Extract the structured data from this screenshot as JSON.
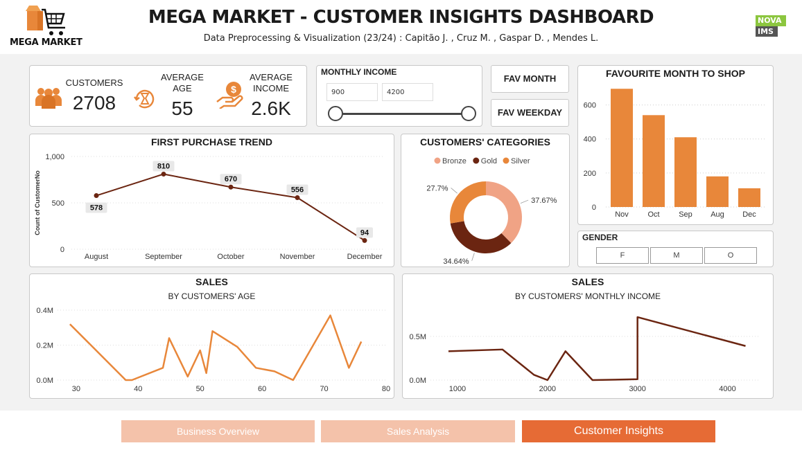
{
  "header": {
    "logo_text": "MEGA MARKET",
    "title": "MEGA MARKET - CUSTOMER INSIGHTS DASHBOARD",
    "subtitle": "Data Preprocessing & Visualization (23/24) : Capitão J. ,  Cruz M. ,  Gaspar D. ,  Mendes L.",
    "badge_top": "NOVA",
    "badge_bottom": "IMS",
    "colors": {
      "accent": "#e8873a",
      "dark": "#6b2511",
      "light_accent": "#f4c2aa",
      "active_nav": "#e66b35"
    }
  },
  "kpis": {
    "customers_label": "CUSTOMERS",
    "customers_value": "2708",
    "age_label_1": "AVERAGE",
    "age_label_2": "AGE",
    "age_value": "55",
    "income_label_1": "AVERAGE",
    "income_label_2": "INCOME",
    "income_value": "2.6K",
    "icons": [
      "people-icon",
      "hourglass-icon",
      "money-hand-icon"
    ]
  },
  "income_slicer": {
    "title": "MONTHLY INCOME",
    "min_value": "900",
    "max_value": "4200"
  },
  "buttons": {
    "fav_month": "FAV MONTH",
    "fav_weekday": "FAV WEEKDAY"
  },
  "fav_month_chart": {
    "title": "FAVOURITE MONTH TO SHOP"
  },
  "first_purchase": {
    "title": "FIRST PURCHASE TREND",
    "ylabel": "Count of CustomerNo"
  },
  "categories": {
    "title": "CUSTOMERS' CATEGORIES",
    "legend": [
      "Bronze",
      "Gold",
      "Silver"
    ]
  },
  "gender": {
    "title": "GENDER",
    "options": [
      "F",
      "M",
      "O"
    ]
  },
  "sales_age": {
    "title": "SALES",
    "subtitle": "BY CUSTOMERS' AGE"
  },
  "sales_income": {
    "title": "SALES",
    "subtitle": "BY CUSTOMERS' MONTHLY INCOME"
  },
  "nav": {
    "business": "Business Overview",
    "sales": "Sales Analysis",
    "customer": "Customer Insights"
  },
  "chart_data": [
    {
      "id": "fav_month",
      "type": "bar",
      "title": "FAVOURITE MONTH TO SHOP",
      "categories": [
        "Nov",
        "Oct",
        "Sep",
        "Aug",
        "Dec"
      ],
      "values": [
        695,
        540,
        410,
        180,
        110
      ],
      "ylim": [
        0,
        700
      ],
      "yticks": [
        "0",
        "200",
        "400",
        "600"
      ],
      "grid": true,
      "color": "#e8873a"
    },
    {
      "id": "first_purchase",
      "type": "line",
      "title": "FIRST PURCHASE TREND",
      "ylabel": "Count of CustomerNo",
      "categories": [
        "August",
        "September",
        "October",
        "November",
        "December"
      ],
      "values": [
        578,
        810,
        670,
        556,
        94
      ],
      "data_labels": [
        "578",
        "810",
        "670",
        "556",
        "94"
      ],
      "ylim": [
        0,
        1000
      ],
      "yticks": [
        "0",
        "500",
        "1,000"
      ],
      "grid": true,
      "color": "#6b2511"
    },
    {
      "id": "categories",
      "type": "pie",
      "title": "CUSTOMERS' CATEGORIES",
      "labels": [
        "Bronze",
        "Gold",
        "Silver"
      ],
      "values": [
        37.67,
        34.64,
        27.7
      ],
      "data_labels": [
        "37.67%",
        "34.64%",
        "27.7%"
      ],
      "colors": [
        "#f0a385",
        "#6b2511",
        "#e8873a"
      ],
      "legend": "top"
    },
    {
      "id": "sales_age",
      "type": "line",
      "title": "SALES",
      "subtitle": "BY CUSTOMERS' AGE",
      "x": [
        29,
        38,
        39,
        44,
        45,
        48,
        50,
        51,
        52,
        56,
        59,
        62,
        65,
        71,
        74,
        76
      ],
      "y": [
        0.32,
        0.0,
        0.0,
        0.07,
        0.24,
        0.02,
        0.17,
        0.04,
        0.28,
        0.19,
        0.07,
        0.05,
        0.0,
        0.37,
        0.07,
        0.22
      ],
      "xlim": [
        27,
        80
      ],
      "ylim": [
        0,
        0.4
      ],
      "xticks": [
        "30",
        "40",
        "50",
        "60",
        "70",
        "80"
      ],
      "yticks": [
        "0.0M",
        "0.2M",
        "0.4M"
      ],
      "grid": true,
      "color": "#e8873a"
    },
    {
      "id": "sales_income",
      "type": "line",
      "title": "SALES",
      "subtitle": "BY CUSTOMERS' MONTHLY INCOME",
      "x": [
        900,
        1500,
        1850,
        2000,
        2200,
        2500,
        3000,
        3000,
        4200
      ],
      "y": [
        0.33,
        0.35,
        0.06,
        0.0,
        0.33,
        0.0,
        0.01,
        0.72,
        0.39
      ],
      "xlim": [
        700,
        4350
      ],
      "ylim": [
        0,
        0.8
      ],
      "xticks": [
        "1000",
        "2000",
        "3000",
        "4000"
      ],
      "yticks": [
        "0.0M",
        "0.5M"
      ],
      "grid": true,
      "color": "#6b2511"
    }
  ]
}
